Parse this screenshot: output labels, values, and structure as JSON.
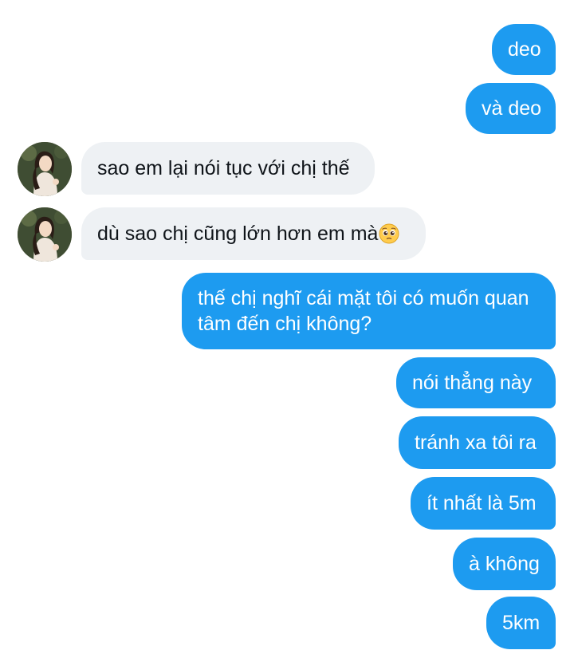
{
  "messages": [
    {
      "id": "m1",
      "side": "outgoing",
      "text": "deo"
    },
    {
      "id": "m2",
      "side": "outgoing",
      "text": "và deo"
    },
    {
      "id": "m3",
      "side": "incoming",
      "text": "sao em lại nói tục với chị thế"
    },
    {
      "id": "m4",
      "side": "incoming",
      "text": "dù sao chị cũng lớn hơn em mà",
      "emoji": "pleading-face-emoji"
    },
    {
      "id": "m5",
      "side": "outgoing",
      "text": "thế chị nghĩ cái mặt tôi có muốn quan tâm đến chị không?"
    },
    {
      "id": "m6",
      "side": "outgoing",
      "text": "nói thẳng này"
    },
    {
      "id": "m7",
      "side": "outgoing",
      "text": "tránh xa tôi ra"
    },
    {
      "id": "m8",
      "side": "outgoing",
      "text": "ít nhất là 5m"
    },
    {
      "id": "m9",
      "side": "outgoing",
      "text": "à không"
    },
    {
      "id": "m10",
      "side": "outgoing",
      "text": "5km"
    }
  ],
  "colors": {
    "outgoing_bubble": "#1d9bf0",
    "incoming_bubble": "#eef1f4",
    "outgoing_text": "#ffffff",
    "incoming_text": "#0f1419"
  },
  "icons": {
    "avatar": "contact-avatar",
    "emoji": "pleading-face-emoji"
  }
}
